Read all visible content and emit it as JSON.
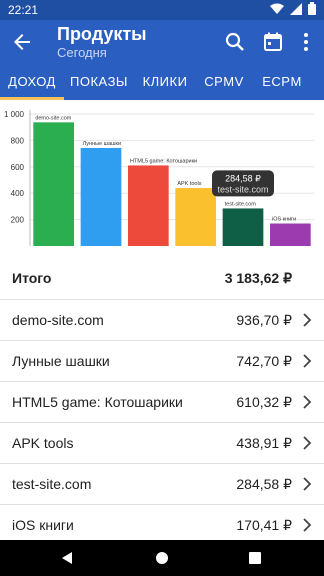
{
  "status": {
    "time": "22:21"
  },
  "app_bar": {
    "title": "Продукты",
    "subtitle": "Сегодня",
    "back_icon": "arrow-back-icon",
    "search_icon": "search-icon",
    "calendar_icon": "calendar-icon",
    "more_icon": "more-vert-icon"
  },
  "tabs": [
    "ДОХОД",
    "ПОКАЗЫ",
    "КЛИКИ",
    "CPMV",
    "ECPM"
  ],
  "active_tab": 0,
  "chart_data": {
    "type": "bar",
    "categories": [
      "demo-site.com",
      "Лунные шашки",
      "HTML5 game: Котошарики",
      "APK tools",
      "test-site.com",
      "iOS книги"
    ],
    "values": [
      936.7,
      742.7,
      610.32,
      438.91,
      284.58,
      170.41
    ],
    "colors": [
      "#2aae50",
      "#2f9ef0",
      "#ee4a3c",
      "#fbc02d",
      "#0f5e46",
      "#9c3bb0"
    ],
    "ylim": [
      0,
      1000
    ],
    "yticks": [
      200,
      400,
      600,
      800,
      1000
    ],
    "ytick_labels": [
      "200",
      "400",
      "600",
      "800",
      "1 000"
    ],
    "tooltip": {
      "value": "284,58 ₽",
      "label": "test-site.com"
    }
  },
  "summary": {
    "label": "Итого",
    "value": "3 183,62 ₽"
  },
  "items": [
    {
      "label": "demo-site.com",
      "value": "936,70 ₽"
    },
    {
      "label": "Лунные шашки",
      "value": "742,70 ₽"
    },
    {
      "label": "HTML5 game: Котошарики",
      "value": "610,32 ₽"
    },
    {
      "label": "APK tools",
      "value": "438,91 ₽"
    },
    {
      "label": "test-site.com",
      "value": "284,58 ₽"
    },
    {
      "label": "iOS книги",
      "value": "170,41 ₽"
    }
  ]
}
